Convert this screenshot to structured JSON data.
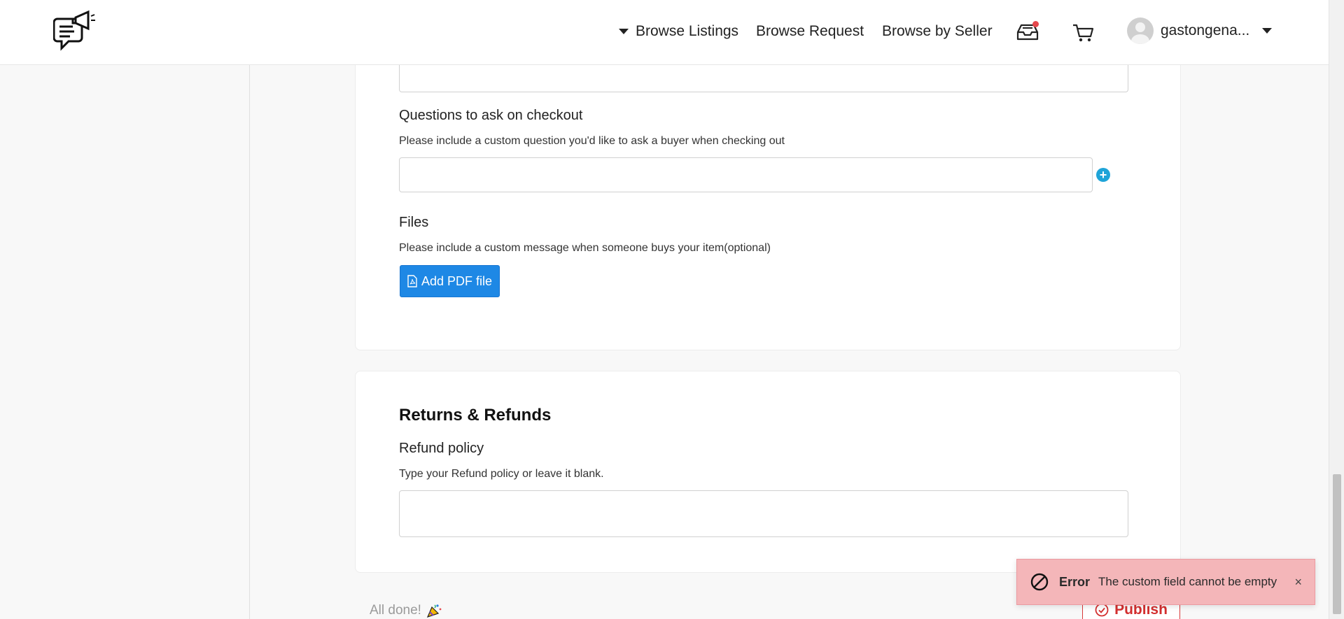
{
  "header": {
    "nav": {
      "browse_listings": "Browse Listings",
      "browse_request": "Browse Request",
      "browse_by_seller": "Browse by Seller"
    },
    "icons": {
      "logo": "chat-megaphone-logo",
      "inbox": "inbox-icon",
      "cart": "cart-icon"
    },
    "user": {
      "name": "gastongena..."
    },
    "accent": "#e5484d"
  },
  "checkout": {
    "questions_label": "Questions to ask on checkout",
    "questions_help": "Please include a custom question you'd like to ask a buyer when checking out",
    "question_value": "",
    "files_label": "Files",
    "files_help": "Please include a custom message when someone buys your item(optional)",
    "add_pdf_label": "Add PDF file",
    "button_color": "#1e88e5"
  },
  "returns": {
    "title": "Returns & Refunds",
    "refund_label": "Refund policy",
    "refund_help": "Type your Refund policy or leave it blank.",
    "refund_value": ""
  },
  "footer": {
    "done_text": "All done!",
    "publish_label": "Publish",
    "publish_color": "#d32f2f"
  },
  "toast": {
    "title": "Error",
    "message": "The custom field cannot be empty",
    "close": "×",
    "color": "#f4b6b9"
  }
}
